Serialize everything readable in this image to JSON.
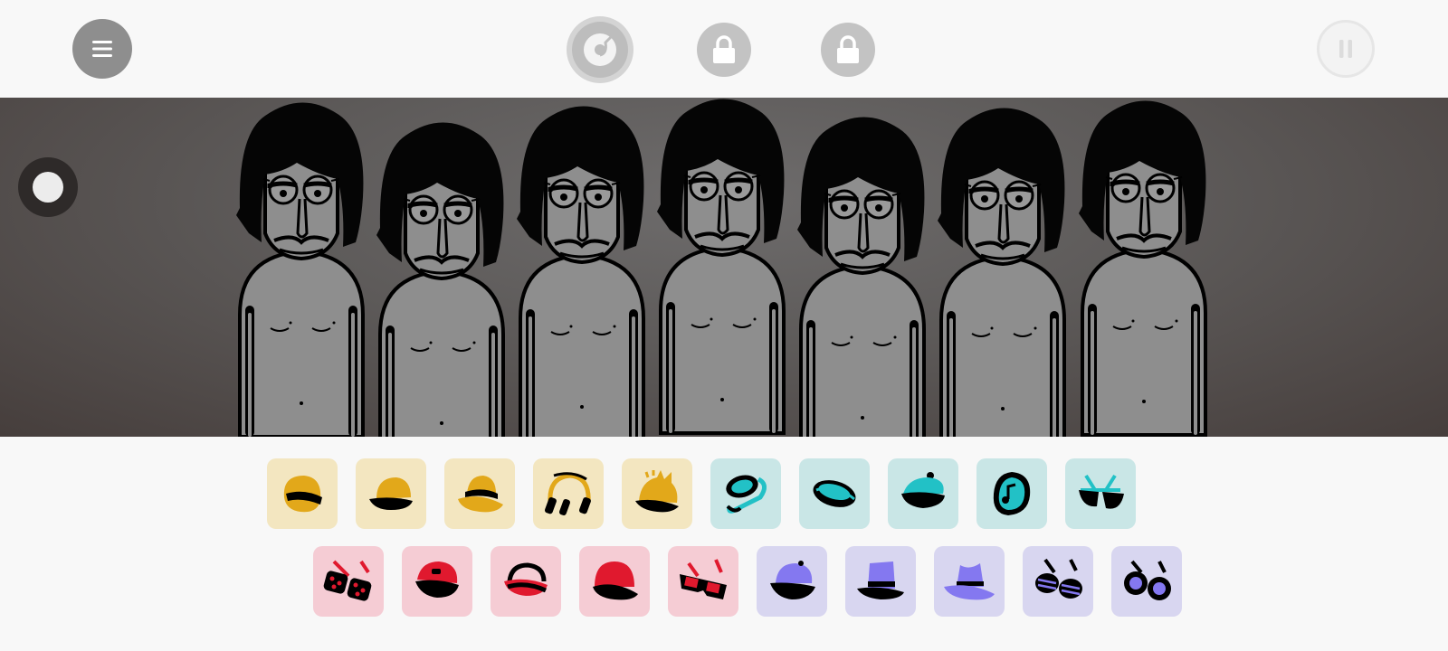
{
  "toolbar": {
    "menu": {
      "icon": "menu-icon"
    },
    "record": {
      "icon": "vinyl-record-icon"
    },
    "locked_slots": [
      {
        "icon": "lock-icon"
      },
      {
        "icon": "lock-icon"
      }
    ],
    "pause": {
      "icon": "pause-icon"
    }
  },
  "stage": {
    "speed_toggle": {
      "icon": "toggle-dot-icon"
    },
    "performers": [
      {
        "slot": 1,
        "state": "empty"
      },
      {
        "slot": 2,
        "state": "empty"
      },
      {
        "slot": 3,
        "state": "empty"
      },
      {
        "slot": 4,
        "state": "empty"
      },
      {
        "slot": 5,
        "state": "empty"
      },
      {
        "slot": 6,
        "state": "empty"
      },
      {
        "slot": 7,
        "state": "empty"
      }
    ],
    "colors": {
      "skin": "#8e8e8e",
      "hair": "#050505",
      "background": "#5d5a59"
    }
  },
  "tray": {
    "row1": [
      {
        "category": "beats",
        "icon": "helmet-visor-icon",
        "bg": "#f3e6c0",
        "fg": "#e2a81a"
      },
      {
        "category": "beats",
        "icon": "cap-icon",
        "bg": "#f3e6c0",
        "fg": "#e2a81a"
      },
      {
        "category": "beats",
        "icon": "bucket-hat-icon",
        "bg": "#f3e6c0",
        "fg": "#e2a81a"
      },
      {
        "category": "beats",
        "icon": "headphones-icon",
        "bg": "#f3e6c0",
        "fg": "#e2a81a"
      },
      {
        "category": "beats",
        "icon": "spiky-hat-icon",
        "bg": "#f3e6c0",
        "fg": "#e2a81a"
      },
      {
        "category": "effects",
        "icon": "mic-hook-icon",
        "bg": "#c9e6e6",
        "fg": "#22c1c6"
      },
      {
        "category": "effects",
        "icon": "visor-icon",
        "bg": "#c9e6e6",
        "fg": "#22c1c6"
      },
      {
        "category": "effects",
        "icon": "beret-icon",
        "bg": "#c9e6e6",
        "fg": "#22c1c6"
      },
      {
        "category": "effects",
        "icon": "music-note-mask-icon",
        "bg": "#c9e6e6",
        "fg": "#22c1c6"
      },
      {
        "category": "effects",
        "icon": "sunglasses-icon",
        "bg": "#c9e6e6",
        "fg": "#22c1c6"
      }
    ],
    "row2": [
      {
        "category": "melodies",
        "icon": "dotted-glasses-icon",
        "bg": "#f5ccd4",
        "fg": "#e0192e"
      },
      {
        "category": "melodies",
        "icon": "captain-hat-icon",
        "bg": "#f5ccd4",
        "fg": "#e0192e"
      },
      {
        "category": "melodies",
        "icon": "visor-cap-icon",
        "bg": "#f5ccd4",
        "fg": "#e0192e"
      },
      {
        "category": "melodies",
        "icon": "beanie-icon",
        "bg": "#f5ccd4",
        "fg": "#e0192e"
      },
      {
        "category": "melodies",
        "icon": "3d-glasses-icon",
        "bg": "#f5ccd4",
        "fg": "#e0192e"
      },
      {
        "category": "voices",
        "icon": "baseball-cap-icon",
        "bg": "#d8d6f0",
        "fg": "#8478f0"
      },
      {
        "category": "voices",
        "icon": "top-hat-icon",
        "bg": "#d8d6f0",
        "fg": "#8478f0"
      },
      {
        "category": "voices",
        "icon": "fedora-icon",
        "bg": "#d8d6f0",
        "fg": "#8478f0"
      },
      {
        "category": "voices",
        "icon": "shutter-shades-icon",
        "bg": "#d8d6f0",
        "fg": "#8478f0"
      },
      {
        "category": "voices",
        "icon": "round-goggles-icon",
        "bg": "#d8d6f0",
        "fg": "#8478f0"
      }
    ]
  }
}
